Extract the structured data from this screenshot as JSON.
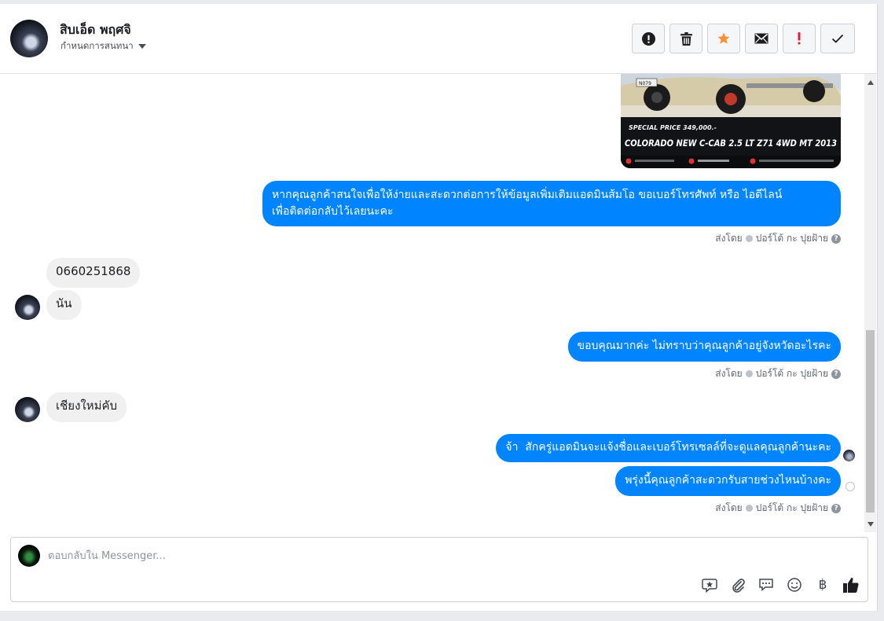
{
  "header": {
    "contact_name": "สิบเอ็ด พฤศจิ",
    "assign_label": "กำหนดการสนทนา",
    "toolbar": [
      {
        "name": "spam-button",
        "icon": "alert-circle-icon"
      },
      {
        "name": "delete-button",
        "icon": "trash-icon"
      },
      {
        "name": "star-button",
        "icon": "star-icon"
      },
      {
        "name": "mark-unread-button",
        "icon": "envelope-icon"
      },
      {
        "name": "follow-up-button",
        "icon": "exclamation-icon"
      },
      {
        "name": "done-button",
        "icon": "check-icon"
      }
    ]
  },
  "chat": {
    "image_caption": {
      "price": "SPECIAL PRICE 349,000.-",
      "model": "COLORADO NEW C-CAB 2.5 LT Z71 4WD MT 2013",
      "plate": "N079"
    },
    "msg1": "หากคุณลูกค้าสนใจเพื่อให้ง่ายและสะดวกต่อการให้ข้อมูลเพิ่มเติมแอดมินส้มโอ ขอเบอร์โทรศัพท์ หรือ ไอดีไลน์",
    "msg1b": "เพื่อติดต่อกลับไว้เลยนะคะ",
    "meta_prefix": "ส่งโดย",
    "meta_agent": "ปอร์โต้ กะ ปุยฝ้าย",
    "in1": "0660251868",
    "in2": "นัน",
    "msg2": "ขอบคุณมากค่ะ ไม่ทราบว่าคุณลูกค้าอยู่จังหวัดอะไรคะ",
    "in3": "เชียงใหม่คับ",
    "msg3": "จ้า  สักครู่แอดมินจะแจ้งชื่อและเบอร์โทรเซลล์ที่จะดูแลคุณลูกค้านะคะ",
    "msg4": "พรุ่งนี้คุณลูกค้าสะดวกรับสายช่วงไหนบ้างคะ"
  },
  "composer": {
    "placeholder": "ตอบกลับใน Messenger...",
    "tools": [
      "saved-reply-icon",
      "attachment-icon",
      "chat-bubbles-icon",
      "emoji-icon",
      "baht-icon",
      "like-icon"
    ],
    "baht_glyph": "฿"
  },
  "colors": {
    "outgoing_bubble": "#0084ff",
    "incoming_bubble": "#f1f0f0",
    "star": "#f7923b",
    "follow_up": "#e41e3f"
  }
}
